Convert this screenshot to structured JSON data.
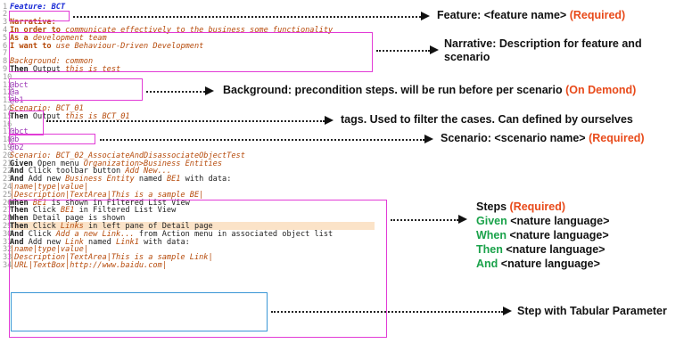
{
  "code": [
    {
      "n": "1",
      "parts": [
        {
          "c": "feat",
          "t": "Feature: BCT"
        }
      ]
    },
    {
      "n": "2",
      "parts": []
    },
    {
      "n": "3",
      "parts": [
        {
          "c": "nar",
          "t": "Narrative:"
        }
      ]
    },
    {
      "n": "4",
      "parts": [
        {
          "c": "nar",
          "t": "In order to "
        },
        {
          "c": "bg",
          "t": "communicate effectively to the business some functionality"
        }
      ]
    },
    {
      "n": "5",
      "parts": [
        {
          "c": "nar",
          "t": "As a "
        },
        {
          "c": "bg",
          "t": "development team"
        }
      ]
    },
    {
      "n": "6",
      "parts": [
        {
          "c": "nar",
          "t": "I want to "
        },
        {
          "c": "bg",
          "t": "use Behaviour-Driven Development"
        }
      ]
    },
    {
      "n": "7",
      "parts": []
    },
    {
      "n": "8",
      "parts": [
        {
          "c": "bg",
          "t": "Background: common"
        }
      ]
    },
    {
      "n": "9",
      "parts": [
        {
          "c": "kw",
          "t": "Then"
        },
        {
          "c": "",
          "t": " Output "
        },
        {
          "c": "it",
          "t": "this is test"
        }
      ]
    },
    {
      "n": "10",
      "parts": []
    },
    {
      "n": "11",
      "parts": [
        {
          "c": "tag",
          "t": "@bct"
        }
      ]
    },
    {
      "n": "12",
      "parts": [
        {
          "c": "tag",
          "t": "@a"
        }
      ]
    },
    {
      "n": "13",
      "parts": [
        {
          "c": "tag",
          "t": "@b1"
        }
      ]
    },
    {
      "n": "14",
      "parts": [
        {
          "c": "scn",
          "t": "Scenario: BCT_01"
        }
      ]
    },
    {
      "n": "15",
      "parts": [
        {
          "c": "kw",
          "t": "Then"
        },
        {
          "c": "",
          "t": " Output "
        },
        {
          "c": "it",
          "t": "this is BCT_01"
        }
      ]
    },
    {
      "n": "16",
      "parts": []
    },
    {
      "n": "17",
      "parts": [
        {
          "c": "tag",
          "t": "@bct"
        }
      ]
    },
    {
      "n": "18",
      "parts": [
        {
          "c": "tag",
          "t": "@b"
        }
      ]
    },
    {
      "n": "19",
      "parts": [
        {
          "c": "tag",
          "t": "@b2"
        }
      ]
    },
    {
      "n": "20",
      "parts": [
        {
          "c": "scn",
          "t": "Scenario: BCT_02_AssociateAndDisassociateObjectTest"
        }
      ]
    },
    {
      "n": "21",
      "parts": [
        {
          "c": "kw",
          "t": "Given"
        },
        {
          "c": "",
          "t": " Open menu "
        },
        {
          "c": "it",
          "t": "Organization>Business Entities"
        }
      ]
    },
    {
      "n": "22",
      "parts": [
        {
          "c": "kw",
          "t": "And"
        },
        {
          "c": "",
          "t": " Click toolbar button "
        },
        {
          "c": "it",
          "t": "Add New..."
        }
      ]
    },
    {
      "n": "23",
      "parts": [
        {
          "c": "kw",
          "t": "And"
        },
        {
          "c": "",
          "t": " Add new "
        },
        {
          "c": "it",
          "t": "Business Entity"
        },
        {
          "c": "",
          "t": " named "
        },
        {
          "c": "it",
          "t": "BE1"
        },
        {
          "c": "",
          "t": " with data:"
        }
      ]
    },
    {
      "n": "24",
      "parts": [
        {
          "c": "tbl",
          "t": "|name|type|value|"
        }
      ]
    },
    {
      "n": "25",
      "parts": [
        {
          "c": "tbl",
          "t": "|Description|TextArea|This is a sample BE|"
        }
      ]
    },
    {
      "n": "26",
      "parts": [
        {
          "c": "kw",
          "t": "When"
        },
        {
          "c": "",
          "t": " "
        },
        {
          "c": "it",
          "t": "BE1"
        },
        {
          "c": "",
          "t": " is shown in Filtered List View"
        }
      ]
    },
    {
      "n": "27",
      "parts": [
        {
          "c": "kw",
          "t": "Then"
        },
        {
          "c": "",
          "t": " Click "
        },
        {
          "c": "it",
          "t": "BE1"
        },
        {
          "c": "",
          "t": " in Filtered List View"
        }
      ]
    },
    {
      "n": "28",
      "parts": [
        {
          "c": "kw",
          "t": "When"
        },
        {
          "c": "",
          "t": " Detail page is shown"
        }
      ]
    },
    {
      "n": "29",
      "parts": [
        {
          "c": "kw",
          "t": "Then"
        },
        {
          "c": "",
          "t": " Click "
        },
        {
          "c": "it",
          "t": "Links"
        },
        {
          "c": "",
          "t": " in left pane of Detail page"
        }
      ]
    },
    {
      "n": "30",
      "parts": [
        {
          "c": "kw",
          "t": "And"
        },
        {
          "c": "",
          "t": " Click "
        },
        {
          "c": "it",
          "t": "Add a new Link..."
        },
        {
          "c": "",
          "t": " from Action menu in associated object list"
        }
      ]
    },
    {
      "n": "31",
      "parts": [
        {
          "c": "kw",
          "t": "And"
        },
        {
          "c": "",
          "t": " Add new "
        },
        {
          "c": "it",
          "t": "Link"
        },
        {
          "c": "",
          "t": " named "
        },
        {
          "c": "it",
          "t": "Link1"
        },
        {
          "c": "",
          "t": " with data:"
        }
      ]
    },
    {
      "n": "32",
      "parts": [
        {
          "c": "tbl",
          "t": "|name|type|value|"
        }
      ]
    },
    {
      "n": "33",
      "parts": [
        {
          "c": "tbl",
          "t": "|Description|TextArea|This is a sample Link|"
        }
      ]
    },
    {
      "n": "34",
      "parts": [
        {
          "c": "tbl",
          "t": "|URL|TextBox|http://www.baidu.com|"
        }
      ]
    }
  ],
  "annotations": {
    "feature": {
      "text": "Feature: <feature name>",
      "req": "(Required)"
    },
    "narrative_line1": "Narrative: Description for feature and",
    "narrative_line2": "scenario",
    "background": {
      "text": "Background: precondition steps. will be run before per scenario",
      "req": "(On Demond)"
    },
    "tags": "tags. Used to filter the cases. Can defined by ourselves",
    "scenario": {
      "text": "Scenario: <scenario name>",
      "req": "(Required)"
    },
    "steps": {
      "title": "Steps",
      "req": "(Required)",
      "lines": [
        {
          "kw": "Given",
          "rest": " <nature language>"
        },
        {
          "kw": "When",
          "rest": " <nature language>"
        },
        {
          "kw": "Then",
          "rest": " <nature language>"
        },
        {
          "kw": "And",
          "rest": " <nature language>"
        }
      ]
    },
    "tabular": "Step with Tabular Parameter"
  }
}
